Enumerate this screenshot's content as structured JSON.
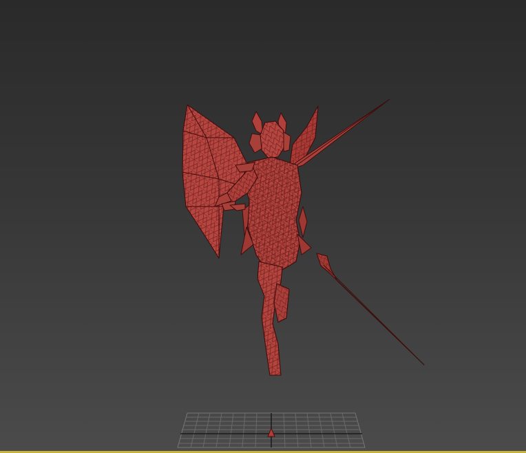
{
  "viewport": {
    "background_top": "#2a2a2a",
    "background_bottom": "#4b4b4b",
    "active_border_color": "#c8b43c",
    "shading_mode": "edged-faces",
    "model_color": "#b23c36",
    "wire_color": "#4a1010"
  },
  "scene": {
    "objects": [
      "winged-character-mesh",
      "home-grid",
      "world-axis-tripod"
    ]
  }
}
